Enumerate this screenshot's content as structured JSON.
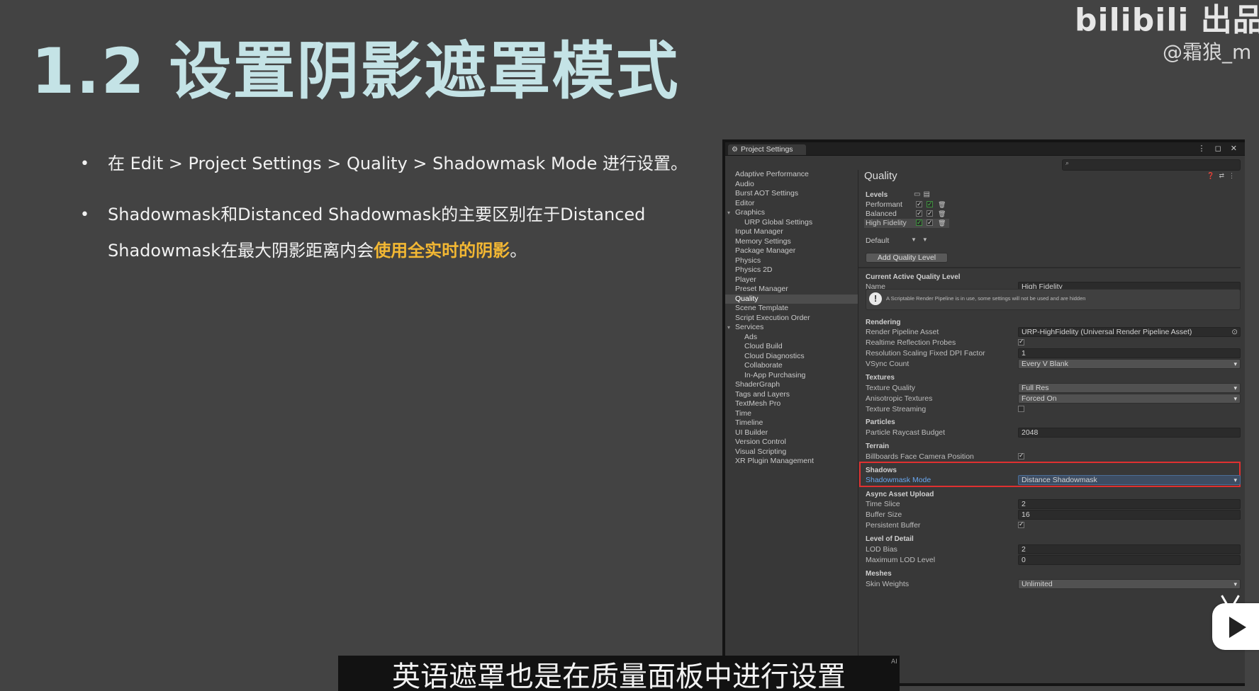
{
  "slide": {
    "title": "1.2 设置阴影遮罩模式",
    "watermark_logo": "bilibili 出品",
    "watermark_user": "@霜狼_m",
    "bullets": [
      {
        "text": "在 Edit > Project Settings > Quality > Shadowmask Mode 进行设置。"
      },
      {
        "text_before": "Shadowmask和Distanced Shadowmask的主要区别在于Distanced Shadowmask在最大阴影距离内会",
        "highlight": "使用全实时的阴影",
        "text_after": "。"
      }
    ],
    "highlight_color": "#f2b733",
    "subtitle": "英语遮罩也是在质量面板中进行设置",
    "subtitle_tag": "AI"
  },
  "window": {
    "tab_title": "Project Settings",
    "controls": "⋮ ◻ ✕",
    "search_placeholder": "",
    "nav": [
      {
        "label": "Adaptive Performance",
        "type": "item"
      },
      {
        "label": "Audio",
        "type": "item"
      },
      {
        "label": "Burst AOT Settings",
        "type": "item"
      },
      {
        "label": "Editor",
        "type": "item"
      },
      {
        "label": "Graphics",
        "type": "grp"
      },
      {
        "label": "URP Global Settings",
        "type": "sub"
      },
      {
        "label": "Input Manager",
        "type": "item"
      },
      {
        "label": "Memory Settings",
        "type": "item"
      },
      {
        "label": "Package Manager",
        "type": "item"
      },
      {
        "label": "Physics",
        "type": "item"
      },
      {
        "label": "Physics 2D",
        "type": "item"
      },
      {
        "label": "Player",
        "type": "item"
      },
      {
        "label": "Preset Manager",
        "type": "item"
      },
      {
        "label": "Quality",
        "type": "sel"
      },
      {
        "label": "Scene Template",
        "type": "item"
      },
      {
        "label": "Script Execution Order",
        "type": "item"
      },
      {
        "label": "Services",
        "type": "grp"
      },
      {
        "label": "Ads",
        "type": "sub"
      },
      {
        "label": "Cloud Build",
        "type": "sub"
      },
      {
        "label": "Cloud Diagnostics",
        "type": "sub"
      },
      {
        "label": "Collaborate",
        "type": "sub"
      },
      {
        "label": "In-App Purchasing",
        "type": "sub"
      },
      {
        "label": "ShaderGraph",
        "type": "item"
      },
      {
        "label": "Tags and Layers",
        "type": "item"
      },
      {
        "label": "TextMesh Pro",
        "type": "item"
      },
      {
        "label": "Time",
        "type": "item"
      },
      {
        "label": "Timeline",
        "type": "item"
      },
      {
        "label": "UI Builder",
        "type": "item"
      },
      {
        "label": "Version Control",
        "type": "item"
      },
      {
        "label": "Visual Scripting",
        "type": "item"
      },
      {
        "label": "XR Plugin Management",
        "type": "item"
      }
    ],
    "page_title": "Quality",
    "levels_label": "Levels",
    "levels": [
      {
        "name": "Performant",
        "pc": true,
        "mobile_green": true
      },
      {
        "name": "Balanced",
        "pc": true,
        "mobile_green": false
      },
      {
        "name": "High Fidelity",
        "pc": true,
        "mobile_green": false,
        "active": true
      }
    ],
    "default_label": "Default",
    "add_button": "Add Quality Level",
    "sections": {
      "current": "Current Active Quality Level",
      "rendering": "Rendering",
      "textures": "Textures",
      "particles": "Particles",
      "terrain": "Terrain",
      "shadows": "Shadows",
      "async": "Async Asset Upload",
      "lod": "Level of Detail",
      "meshes": "Meshes"
    },
    "name_label": "Name",
    "name_value": "High Fidelity",
    "help_text": "A Scriptable Render Pipeline is in use, some settings will not be used and are hidden",
    "props": {
      "rp_asset": {
        "label": "Render Pipeline Asset",
        "value": "URP-HighFidelity (Universal Render Pipeline Asset)"
      },
      "realtime_probes": {
        "label": "Realtime Reflection Probes",
        "checked": true
      },
      "res_scaling": {
        "label": "Resolution Scaling Fixed DPI Factor",
        "value": "1"
      },
      "vsync": {
        "label": "VSync Count",
        "value": "Every V Blank"
      },
      "tex_quality": {
        "label": "Texture Quality",
        "value": "Full Res"
      },
      "aniso": {
        "label": "Anisotropic Textures",
        "value": "Forced On"
      },
      "tex_stream": {
        "label": "Texture Streaming",
        "checked": false
      },
      "raycast_budget": {
        "label": "Particle Raycast Budget",
        "value": "2048"
      },
      "billboards": {
        "label": "Billboards Face Camera Position",
        "checked": true
      },
      "shadowmask": {
        "label": "Shadowmask Mode",
        "value": "Distance Shadowmask"
      },
      "time_slice": {
        "label": "Time Slice",
        "value": "2"
      },
      "buffer_size": {
        "label": "Buffer Size",
        "value": "16"
      },
      "persistent": {
        "label": "Persistent Buffer",
        "checked": true
      },
      "lod_bias": {
        "label": "LOD Bias",
        "value": "2"
      },
      "max_lod": {
        "label": "Maximum LOD Level",
        "value": "0"
      },
      "skin_weights": {
        "label": "Skin Weights",
        "value": "Unlimited"
      }
    }
  }
}
